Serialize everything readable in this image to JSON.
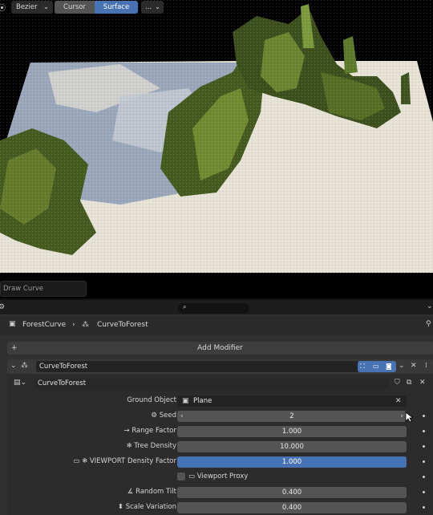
{
  "viewport": {
    "curve_type": "Bezier",
    "mode_options": [
      "Cursor",
      "Surface"
    ],
    "active_mode": "Surface",
    "more_label": "...",
    "draw_curve_label": "Draw Curve"
  },
  "breadcrumb": {
    "object": "ForestCurve",
    "modifier": "CurveToForest"
  },
  "add_modifier_label": "Add Modifier",
  "modifier": {
    "name": "CurveToForest",
    "node_group": "CurveToForest",
    "inputs": [
      {
        "label": "Ground Object",
        "value": "Plane"
      },
      {
        "label": "Seed",
        "value": "2"
      },
      {
        "label": "Range Factor",
        "value": "1.000"
      },
      {
        "label": "Tree Density",
        "value": "10.000"
      },
      {
        "label": "VIEWPORT Density Factor",
        "value": "1.000"
      },
      {
        "label": "Viewport Proxy",
        "value": ""
      },
      {
        "label": "Random Tilt",
        "value": "0.400"
      },
      {
        "label": "Scale Variation",
        "value": "0.400"
      }
    ]
  },
  "colors": {
    "accent": "#4772b3",
    "panel": "#303030",
    "field": "#545454",
    "snow": "#e6e2d6",
    "tree": "#445a1e"
  }
}
